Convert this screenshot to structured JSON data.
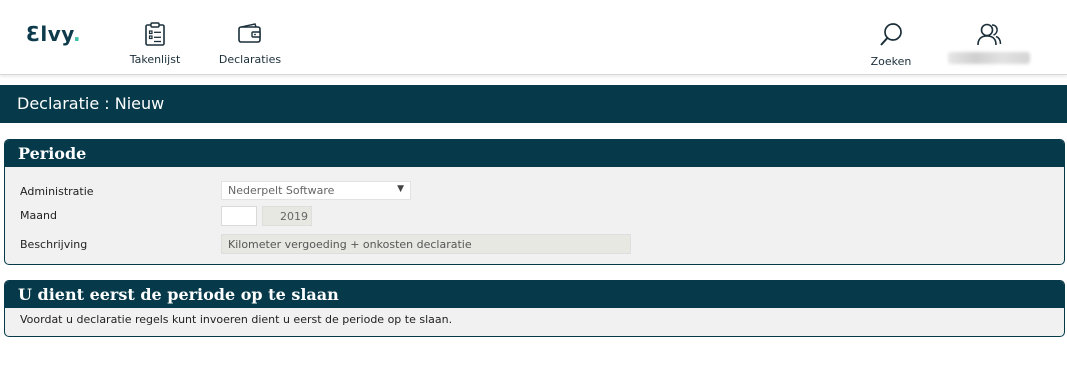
{
  "app": {
    "logo_text": "Ɛlvy",
    "logo_dot": "."
  },
  "nav": {
    "takenlijst": "Takenlijst",
    "declaraties": "Declaraties",
    "zoeken": "Zoeken"
  },
  "page": {
    "title": "Declaratie : Nieuw"
  },
  "periode": {
    "header": "Periode",
    "administratie_label": "Administratie",
    "administratie_value": "Nederpelt Software",
    "maand_label": "Maand",
    "maand_value": "",
    "jaar_value": "2019",
    "beschrijving_label": "Beschrijving",
    "beschrijving_value": "Kilometer vergoeding + onkosten declaratie"
  },
  "notice": {
    "header": "U dient eerst de periode op te slaan",
    "text": "Voordat u declaratie regels kunt invoeren dient u eerst de periode op te slaan."
  },
  "colors": {
    "primary": "#063a4a",
    "accent": "#3fc1a7",
    "panel_bg": "#f1f1f1"
  },
  "icons": [
    "clipboard-list-icon",
    "wallet-icon",
    "search-icon",
    "users-icon",
    "dropdown-arrow-icon"
  ]
}
